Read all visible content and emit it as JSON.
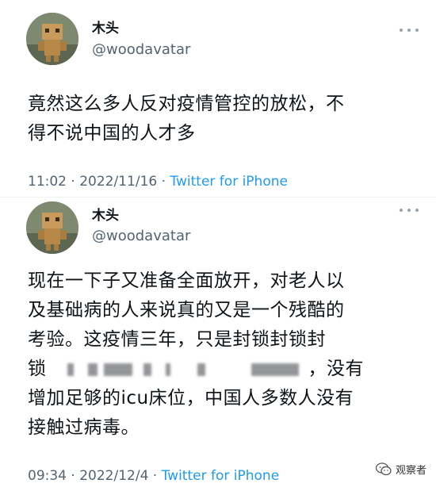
{
  "tweets": [
    {
      "author_name": "木头",
      "author_handle": "@woodavatar",
      "text_lines": [
        "竟然这么多人反对疫情管控的放松，不",
        "得不说中国的人才多"
      ],
      "time": "11:02",
      "date": "2022/11/16",
      "source": "Twitter for iPhone",
      "avatar_icon": "cardboard-robot-avatar"
    },
    {
      "author_name": "木头",
      "author_handle": "@woodavatar",
      "text_lines": [
        "现在一下子又准备全面放开，对老人以",
        "及基础病的人来说真的又是一个残酷的",
        "考验。这疫情三年，只是封锁封锁封",
        "锁",
        "，没有",
        "增加足够的icu床位，中国人多数人没有",
        "接触过病毒。"
      ],
      "time": "09:34",
      "date": "2022/12/4",
      "source": "Twitter for iPhone",
      "avatar_icon": "cardboard-robot-avatar"
    }
  ],
  "separator": " · ",
  "watermark": {
    "icon": "wechat-icon",
    "text": "观察者"
  },
  "colors": {
    "link": "#1d9bf0",
    "secondary_text": "#536471",
    "primary_text": "#0f1419"
  }
}
